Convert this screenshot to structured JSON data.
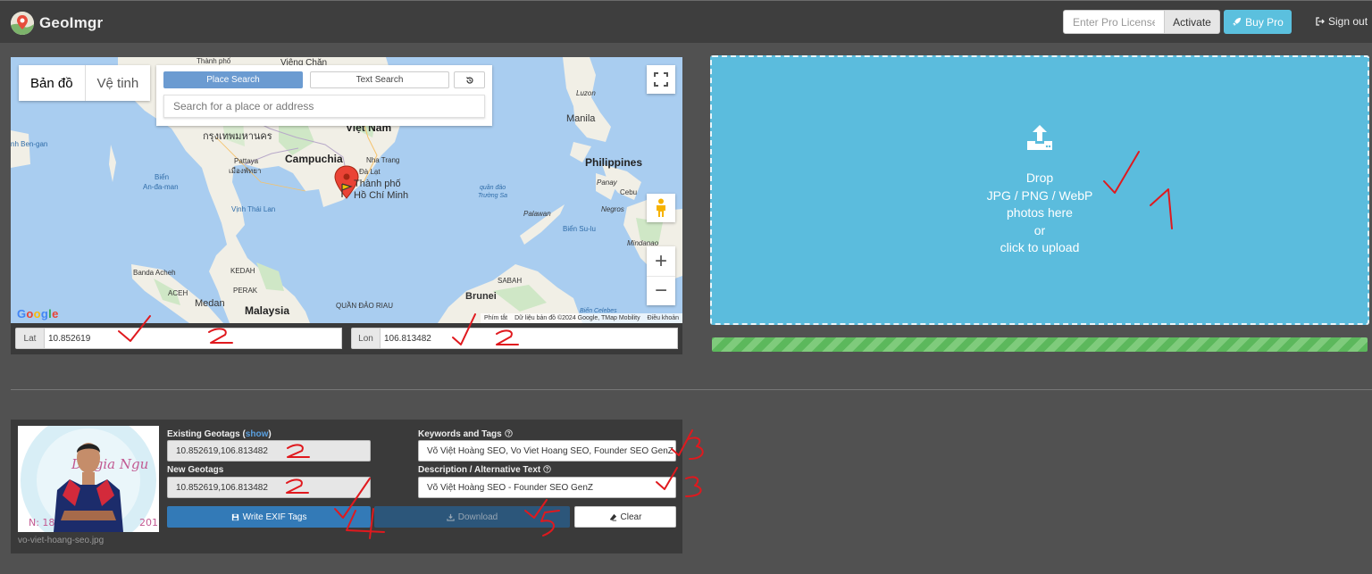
{
  "navbar": {
    "brand": "GeoImgr",
    "license_placeholder": "Enter Pro License",
    "activate_label": "Activate",
    "buypro_label": "Buy Pro",
    "signout_label": "Sign out"
  },
  "map": {
    "maptype": [
      "Bản đồ",
      "Vệ tinh"
    ],
    "search_tabs": {
      "place": "Place Search",
      "text": "Text Search"
    },
    "search_placeholder": "Search for a place or address",
    "labels": {
      "thanh_pho": "Thành phố",
      "vieng_chan": "Viêng Chăn",
      "bangkok": "กรุงเทพมหานคร",
      "viet_nam": "Việt Nam",
      "campuchia": "Campuchia",
      "nha_trang": "Nha Trang",
      "da_lat": "Đà Lạt",
      "hcm1": "Thành phố",
      "hcm2": "Hồ Chí Minh",
      "pattaya1": "Pattaya",
      "pattaya2": "เมืองพัทยา",
      "vinh_thai_lan": "Vịnh Thái Lan",
      "bien_andaman1": "Biển",
      "bien_andaman2": "An-đa-man",
      "ben_gan": "nh Ben-gan",
      "luzon": "Luzon",
      "manila": "Manila",
      "philippines": "Philippines",
      "panay": "Panay",
      "cebu": "Cebu",
      "negros": "Negros",
      "palawan": "Palawan",
      "truong_sa1": "quần đảo",
      "truong_sa2": "Trường Sa",
      "bien_sulu": "Biển Su-lu",
      "mindanao": "Mindanao",
      "banda_aceh": "Banda Acheh",
      "kedah": "KEDAH",
      "perak": "PERAK",
      "aceh": "ACEH",
      "medan": "Medan",
      "malaysia": "Malaysia",
      "quan_dao_riau": "QUẦN ĐẢO RIAU",
      "sabah": "SABAH",
      "brunei": "Brunei",
      "bien_celebes": "Biển Celebes"
    },
    "google": "Google",
    "attribution": [
      "Phím tắt",
      "Dữ liệu bản đồ ©2024 Google, TMap Mobility",
      "Điều khoản"
    ],
    "lat_label": "Lat",
    "lat_value": "10.852619",
    "lon_label": "Lon",
    "lon_value": "106.813482"
  },
  "dropzone": {
    "lines": [
      "Drop",
      "JPG / PNG / WebP",
      "photos here",
      "or",
      "click to upload"
    ],
    "progress_fraction": 1.0
  },
  "file": {
    "filename": "vo-viet-hoang-seo.jpg",
    "existing_label": "Existing Geotags (",
    "existing_link": "show",
    "existing_close": ")",
    "existing_value": "10.852619,106.813482",
    "new_label": "New Geotags",
    "new_value": "10.852619,106.813482",
    "keywords_label": "Keywords and Tags",
    "keywords_value": "Võ Việt Hoàng SEO, Vo Viet Hoang SEO, Founder SEO GenZ",
    "description_label": "Description / Alternative Text",
    "description_value": "Võ Việt Hoàng SEO - Founder SEO GenZ",
    "write_label": "Write EXIF Tags",
    "download_label": "Download",
    "clear_label": "Clear"
  },
  "colors": {
    "page_bg": "#515151",
    "navbar_bg": "#3e3e3e",
    "dropzone_bg": "#5bbcdd",
    "primary": "#337ab7",
    "info": "#5bc0de",
    "success": "#5cb85c",
    "annotation_red": "#e0191e"
  },
  "icons": [
    "map-pin-logo-icon",
    "rocket-icon",
    "sign-out-icon",
    "history-icon",
    "fullscreen-icon",
    "pegman-icon",
    "map-marker-icon",
    "upload-icon",
    "save-icon",
    "download-icon",
    "eraser-icon",
    "question-circle-icon"
  ]
}
